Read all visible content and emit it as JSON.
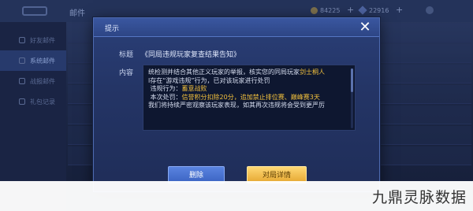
{
  "background": {
    "header_title": "邮件",
    "coins": "84225",
    "gems": "22916",
    "sidebar_items": [
      "好友邮件",
      "系统邮件",
      "战报邮件",
      "礼包记录"
    ]
  },
  "dialog": {
    "title": "提示",
    "close_glyph": "✕",
    "subject_label": "标题",
    "subject": "《同局违规玩家复查结果告知》",
    "content_label": "内容",
    "content": {
      "line1": "统检测并结合其他正义玩家的举报，核实您的同局玩家",
      "line1_highlight": "剑士桐人",
      "line2": "l存在“游戏违规”行为，已对该玩家进行处罚",
      "line3_label": "违规行为：",
      "line3_value": "蓄意战败",
      "line4_label": "本次处罚：",
      "line4_value": "信誉积分扣除20分，",
      "line4_extra": "追加禁止排位赛、巅峰赛3天",
      "line5": "我们将持续严密观察该玩家表现，如其再次违规将会受到更严厉"
    },
    "delete_label": "删除",
    "detail_label": "对局详情"
  },
  "watermark": "九鼎灵脉数据",
  "colors": {
    "highlight": "#f3c13d",
    "highlight_green": "#7ee05a",
    "delete_button": "#4a74d6",
    "detail_button": "#f0bb4a"
  }
}
